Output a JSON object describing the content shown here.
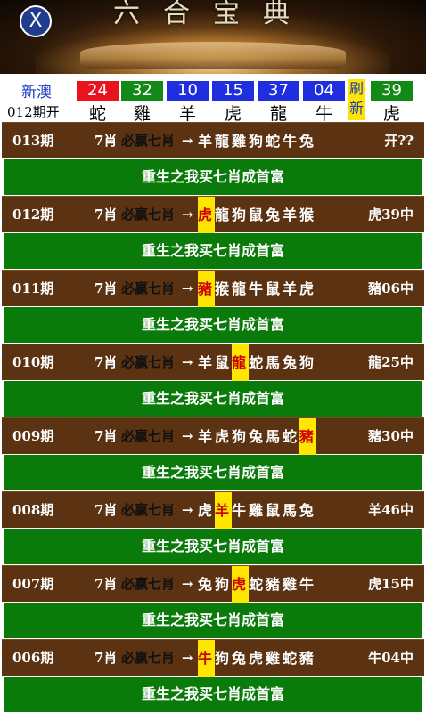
{
  "banner": {
    "title": "六合宝典",
    "close_label": "X"
  },
  "results": {
    "label_top": "新澳",
    "label_bottom": "012期开",
    "refresh_label_1": "刷",
    "refresh_label_2": "新",
    "balls": [
      {
        "number": "24",
        "zodiac": "蛇",
        "color": "#e8131c"
      },
      {
        "number": "32",
        "zodiac": "雞",
        "color": "#138a18"
      },
      {
        "number": "10",
        "zodiac": "羊",
        "color": "#1f2fe0"
      },
      {
        "number": "15",
        "zodiac": "虎",
        "color": "#1f2fe0"
      },
      {
        "number": "37",
        "zodiac": "龍",
        "color": "#1f2fe0"
      },
      {
        "number": "04",
        "zodiac": "牛",
        "color": "#1f2fe0"
      },
      {
        "number": "39",
        "zodiac": "虎",
        "color": "#138a18"
      }
    ]
  },
  "rows": [
    {
      "period": "013期",
      "count": "7肖",
      "win": "必赢七肖",
      "arrow": "→",
      "animals": [
        "羊",
        "龍",
        "雞",
        "狗",
        "蛇",
        "牛",
        "兔"
      ],
      "hit": -1,
      "result": "开??"
    },
    {
      "period": "012期",
      "count": "7肖",
      "win": "必赢七肖",
      "arrow": "→",
      "animals": [
        "虎",
        "龍",
        "狗",
        "鼠",
        "兔",
        "羊",
        "猴"
      ],
      "hit": 0,
      "result": "虎39中"
    },
    {
      "period": "011期",
      "count": "7肖",
      "win": "必赢七肖",
      "arrow": "→",
      "animals": [
        "豬",
        "猴",
        "龍",
        "牛",
        "鼠",
        "羊",
        "虎"
      ],
      "hit": 0,
      "result": "豬06中"
    },
    {
      "period": "010期",
      "count": "7肖",
      "win": "必赢七肖",
      "arrow": "→",
      "animals": [
        "羊",
        "鼠",
        "龍",
        "蛇",
        "馬",
        "兔",
        "狗"
      ],
      "hit": 2,
      "result": "龍25中"
    },
    {
      "period": "009期",
      "count": "7肖",
      "win": "必赢七肖",
      "arrow": "→",
      "animals": [
        "羊",
        "虎",
        "狗",
        "兔",
        "馬",
        "蛇",
        "豬"
      ],
      "hit": 6,
      "result": "豬30中"
    },
    {
      "period": "008期",
      "count": "7肖",
      "win": "必赢七肖",
      "arrow": "→",
      "animals": [
        "虎",
        "羊",
        "牛",
        "雞",
        "鼠",
        "馬",
        "兔"
      ],
      "hit": 1,
      "result": "羊46中"
    },
    {
      "period": "007期",
      "count": "7肖",
      "win": "必赢七肖",
      "arrow": "→",
      "animals": [
        "兔",
        "狗",
        "虎",
        "蛇",
        "豬",
        "雞",
        "牛"
      ],
      "hit": 2,
      "result": "虎15中"
    },
    {
      "period": "006期",
      "count": "7肖",
      "win": "必赢七肖",
      "arrow": "→",
      "animals": [
        "牛",
        "狗",
        "兔",
        "虎",
        "雞",
        "蛇",
        "豬"
      ],
      "hit": 0,
      "result": "牛04中"
    }
  ],
  "promo_text": "重生之我买七肖成首富"
}
